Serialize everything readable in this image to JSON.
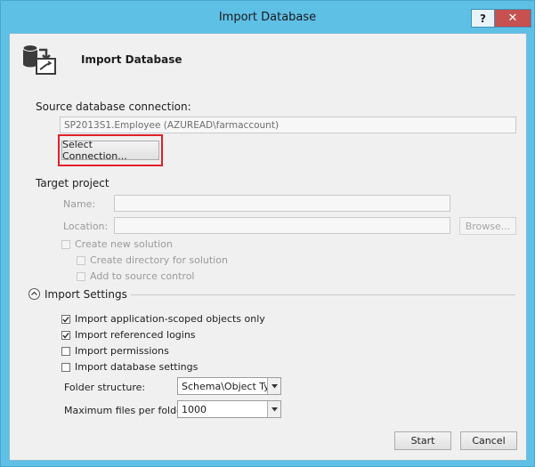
{
  "window": {
    "title": "Import Database",
    "help_label": "?",
    "close_label": "✕"
  },
  "header": {
    "title": "Import Database",
    "icon": "import-database-icon"
  },
  "source": {
    "label": "Source database connection:",
    "value": "SP2013S1.Employee (AZUREAD\\farmaccount)",
    "select_button": "Select Connection..."
  },
  "target": {
    "label": "Target project",
    "name_label": "Name:",
    "location_label": "Location:",
    "browse_button": "Browse...",
    "create_solution": "Create new solution",
    "create_directory": "Create directory for solution",
    "add_source_control": "Add to source control"
  },
  "import_settings": {
    "label": "Import Settings",
    "options": [
      {
        "label": "Import application-scoped objects only",
        "checked": true
      },
      {
        "label": "Import referenced logins",
        "checked": true
      },
      {
        "label": "Import permissions",
        "checked": false
      },
      {
        "label": "Import database settings",
        "checked": false
      }
    ],
    "folder_structure_label": "Folder structure:",
    "folder_structure_value": "Schema\\Object Type",
    "max_files_label": "Maximum files per folder:",
    "max_files_value": "1000"
  },
  "footer": {
    "start_button": "Start",
    "cancel_button": "Cancel"
  },
  "colors": {
    "title_bar": "#5fc0e6",
    "close_button": "#c75050",
    "highlight": "#e0202a"
  }
}
